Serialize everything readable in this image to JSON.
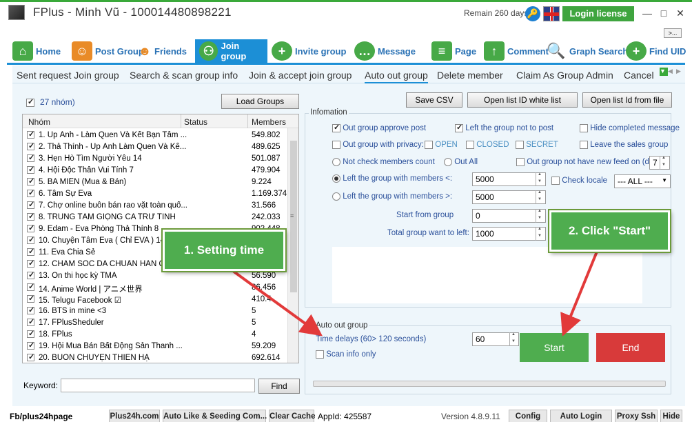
{
  "window": {
    "title": "FPlus - Minh Vũ - 100014480898221",
    "remain": "Remain 260 days",
    "login_label": "Login license",
    "more_label": ">..."
  },
  "nav": [
    {
      "label": "Home",
      "icon": "home-icon"
    },
    {
      "label": "Post Group",
      "icon": "people-icon"
    },
    {
      "label": "Friends",
      "icon": "friends-icon"
    },
    {
      "label": "Join group",
      "icon": "join-group-icon"
    },
    {
      "label": "Invite group",
      "icon": "add-user-icon"
    },
    {
      "label": "Message",
      "icon": "chat-icon"
    },
    {
      "label": "Page",
      "icon": "document-icon"
    },
    {
      "label": "Comment",
      "icon": "arrow-up-icon"
    },
    {
      "label": "Graph Search",
      "icon": "search-icon"
    },
    {
      "label": "Find UID",
      "icon": "find-user-icon"
    }
  ],
  "subtabs": [
    "Sent request Join group",
    "Search & scan group info",
    "Join & accept join group",
    "Auto out group",
    "Delete member",
    "Claim As Group Admin",
    "Cancel"
  ],
  "left": {
    "count_label": "27 nhóm)",
    "load_groups": "Load Groups",
    "columns": [
      "Nhóm",
      "Status",
      "Members"
    ],
    "rows": [
      {
        "name": "1. Up Ảnh - Làm Quen Và Kết Bạn Tâm ...",
        "members": "549.802"
      },
      {
        "name": "2. Thả Thính - Up Ảnh Làm Quen Và Kế...",
        "members": "489.625"
      },
      {
        "name": "3. Hẹn Hò Tìm Người Yêu 14",
        "members": "501.087"
      },
      {
        "name": "4. Hội Độc Thân Vui Tính 7",
        "members": "479.904"
      },
      {
        "name": "5. BA MIỀN (Mua & Bán)",
        "members": "9.224"
      },
      {
        "name": "6. Tâm Sự Eva",
        "members": "1.169.374"
      },
      {
        "name": "7. Chợ online buôn bán rao vặt toàn quố...",
        "members": "31.566"
      },
      {
        "name": "8. TRUNG TÂM GIỌNG CA TRỮ TÌNH",
        "members": "242.033"
      },
      {
        "name": "9. Edam - Eva Phòng Thả Thính 8",
        "members": "902.448"
      },
      {
        "name": "10. Chuyện Tâm Eva ( Chỉ EVA ) 14",
        "members": ""
      },
      {
        "name": "11. Eva Chia Sẻ",
        "members": ""
      },
      {
        "name": "12. CHĂM SÓC DA CHUẨN HÀN QUỐC",
        "members": ""
      },
      {
        "name": "13. Ôn thi học kỳ TMA",
        "members": "56.590"
      },
      {
        "name": "14. Anime World | アニメ世界",
        "members": "86.456"
      },
      {
        "name": "15. Telugu Facebook ☑",
        "members": "410.4"
      },
      {
        "name": "16. BTS in mine <3",
        "members": "5"
      },
      {
        "name": "17. FPlusSheduler",
        "members": "5"
      },
      {
        "name": "18. FPlus",
        "members": "4"
      },
      {
        "name": "19. Hội Mua Bán Bất Động Sản Thanh ...",
        "members": "59.209"
      },
      {
        "name": "20. BUÔN CHUYỆN THIÊN HẠ",
        "members": "692.614"
      }
    ],
    "keyword_label": "Keyword:",
    "keyword_value": "",
    "find_label": "Find"
  },
  "right": {
    "save_csv": "Save CSV",
    "open_whitelist": "Open list ID white list",
    "open_file": "Open list Id from file",
    "info_legend": "Infomation",
    "opt_approve": "Out group approve post",
    "opt_not_post": "Left the group not to post",
    "opt_hide": "Hide completed message",
    "opt_privacy": "Out group with privacy:",
    "privacy_open": "OPEN",
    "privacy_closed": "CLOSED",
    "privacy_secret": "SECRET",
    "opt_sales": "Leave the sales group",
    "radio_not_check": "Not check members count",
    "radio_out_all": "Out All",
    "opt_no_feed": "Out group not have new feed on (day",
    "no_feed_days": "7",
    "radio_lt": "Left the group with members <:",
    "lt_value": "5000",
    "check_locale": "Check locale",
    "locale_value": "--- ALL ---",
    "radio_gt": "Left the group with members >:",
    "gt_value": "5000",
    "start_from_label": "Start from group",
    "start_from_value": "0",
    "total_label": "Total group want to left:",
    "total_value": "1000",
    "auto_legend": "Auto out group",
    "delays_label": "Time delays (60> 120 seconds)",
    "delays_value": "60",
    "scan_info": "Scan info only",
    "start_label": "Start",
    "end_label": "End"
  },
  "callouts": {
    "setting_time": "1. Setting time",
    "click_start": "2. Click \"Start\""
  },
  "status": {
    "fb": "Fb/plus24hpage",
    "plus24h": "Plus24h.com",
    "auto_like": "Auto Like & Seeding Com...",
    "clear_cache": "Clear Cache",
    "appid": "AppId: 425587",
    "version": "Version 4.8.9.11",
    "config": "Config",
    "auto_login": "Auto Login",
    "proxy": "Proxy Ssh",
    "hide": "Hide"
  }
}
